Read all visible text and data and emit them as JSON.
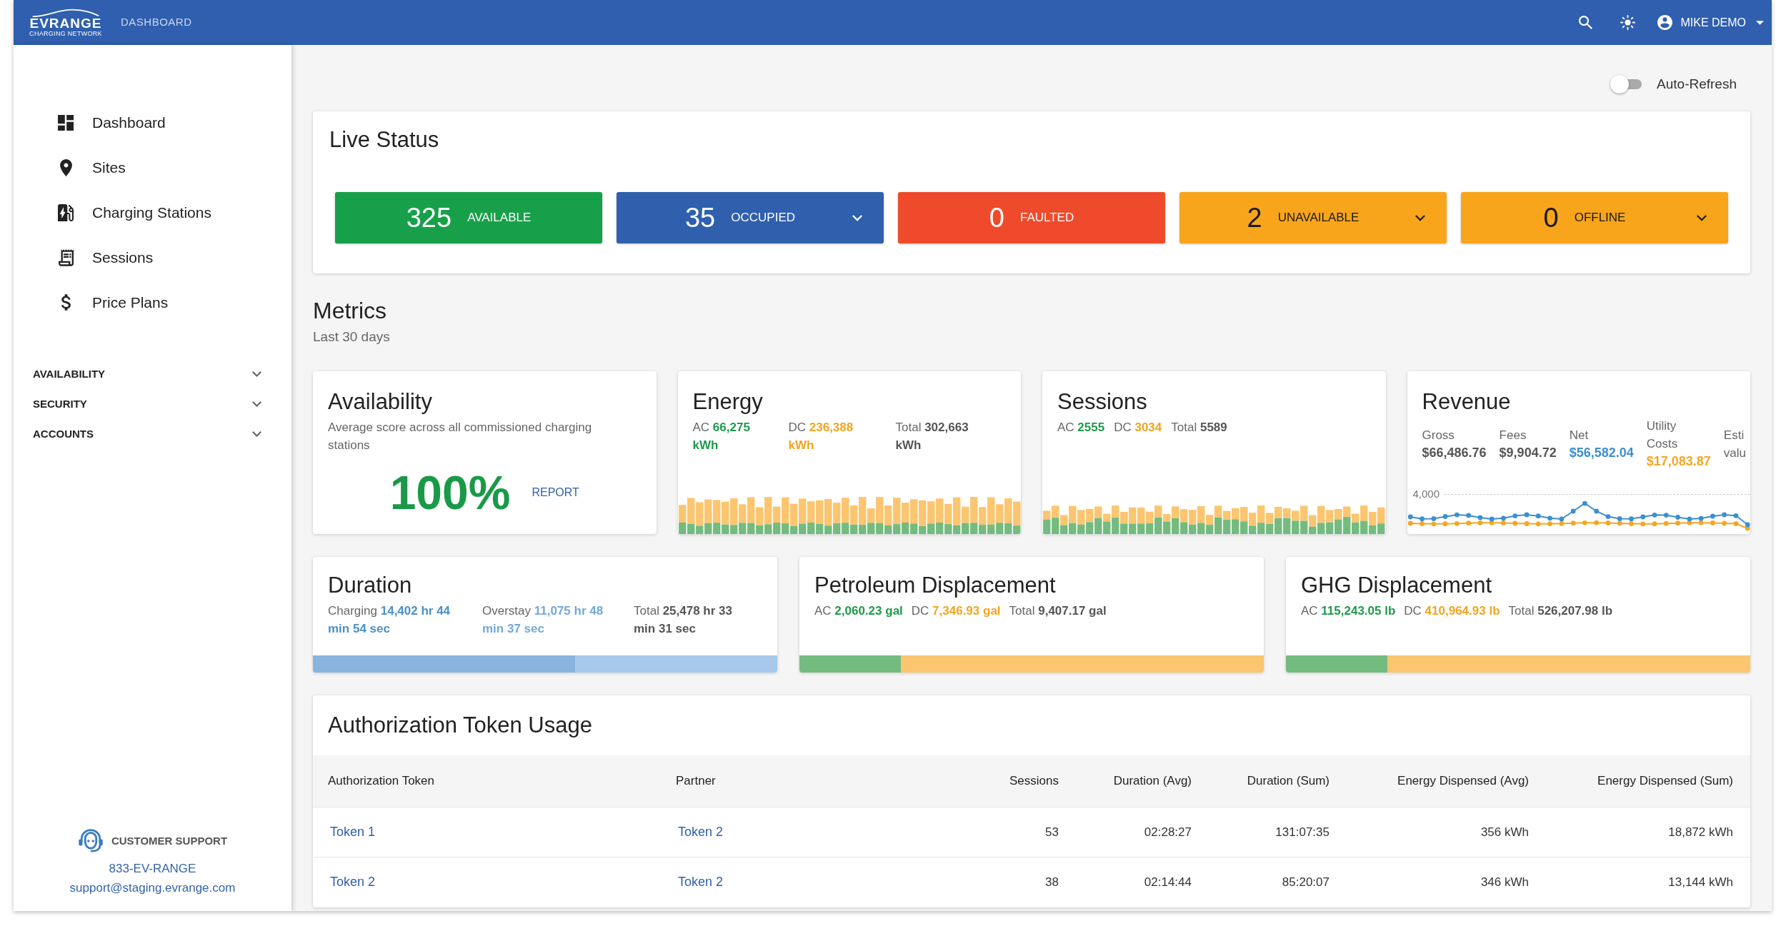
{
  "header": {
    "logo": {
      "name": "EVRANGE",
      "tagline": "CHARGING NETWORK"
    },
    "page_title": "DASHBOARD",
    "user": "MIKE DEMO"
  },
  "sidebar": {
    "nav": [
      {
        "label": "Dashboard"
      },
      {
        "label": "Sites"
      },
      {
        "label": "Charging Stations"
      },
      {
        "label": "Sessions"
      },
      {
        "label": "Price Plans"
      }
    ],
    "sections": [
      {
        "label": "AVAILABILITY",
        "expanded": false
      },
      {
        "label": "SECURITY",
        "expanded": false
      },
      {
        "label": "ACCOUNTS",
        "expanded": false
      }
    ],
    "support": {
      "title": "CUSTOMER SUPPORT",
      "phone": "833-EV-RANGE",
      "email": "support@staging.evrange.com"
    }
  },
  "auto_refresh": {
    "label": "Auto-Refresh",
    "on": false
  },
  "live_status": {
    "title": "Live Status",
    "tiles": [
      {
        "count": "325",
        "label": "AVAILABLE",
        "color": "#17a049",
        "kind": "plain"
      },
      {
        "count": "35",
        "label": "OCCUPIED",
        "color": "#305fae",
        "kind": "dropdown"
      },
      {
        "count": "0",
        "label": "FAULTED",
        "color": "#ef4a2b",
        "kind": "plain"
      },
      {
        "count": "2",
        "label": "UNAVAILABLE",
        "color": "#f8a51b",
        "kind": "dropdown"
      },
      {
        "count": "0",
        "label": "OFFLINE",
        "color": "#f8a51b",
        "kind": "dropdown"
      }
    ]
  },
  "metrics": {
    "title": "Metrics",
    "subtitle": "Last 30 days",
    "cards": [
      {
        "kind": "availability",
        "title": "Availability",
        "description": "Average score across all commissioned charging stations",
        "score": "100%",
        "link": "REPORT"
      },
      {
        "kind": "energy",
        "title": "Energy",
        "stats": [
          {
            "label": "AC",
            "value": "66,275 kWh",
            "color": "#1e9a4a"
          },
          {
            "label": "DC",
            "value": "236,388 kWh",
            "color": "#f2a51f"
          },
          {
            "label": "Total",
            "value": "302,663 kWh",
            "color": "#555555"
          }
        ]
      },
      {
        "kind": "sessions",
        "title": "Sessions",
        "stats": [
          {
            "label": "AC",
            "value": "2555",
            "color": "#1e9a4a"
          },
          {
            "label": "DC",
            "value": "3034",
            "color": "#f2a51f"
          },
          {
            "label": "Total",
            "value": "5589",
            "color": "#555555"
          }
        ]
      },
      {
        "kind": "revenue",
        "title": "Revenue",
        "stats": [
          {
            "label": "Gross",
            "value": "$66,486.76",
            "color": "#555555"
          },
          {
            "label": "Fees",
            "value": "$9,904.72",
            "color": "#555555"
          },
          {
            "label": "Net",
            "value": "$56,582.04",
            "color": "#3d8fd0"
          },
          {
            "label": "Utility Costs",
            "value": "$17,083.87",
            "color": "#f5a623"
          },
          {
            "label": "Esti valu"
          }
        ],
        "chart_label": "4,000"
      },
      {
        "kind": "duration",
        "title": "Duration",
        "stats": [
          {
            "label": "Charging",
            "value": "14,402 hr 44 min 54 sec",
            "color": "#4a90c8"
          },
          {
            "label": "Overstay",
            "value": "11,075 hr 48 min 37 sec",
            "color": "#72a9db"
          },
          {
            "label": "Total",
            "value": "25,478 hr 33 min 31 sec",
            "color": "#555555"
          }
        ],
        "bar": {
          "level": 0.565
        }
      },
      {
        "kind": "displacement",
        "title": "Petroleum Displacement",
        "stats": [
          {
            "label": "AC",
            "value": "2,060.23 gal",
            "color": "#1e9a4a"
          },
          {
            "label": "DC",
            "value": "7,346.93 gal",
            "color": "#f2a51f"
          },
          {
            "label": "Total",
            "value": "9,407.17 gal",
            "color": "#555555"
          }
        ],
        "bar": {
          "level": 0.219
        }
      },
      {
        "kind": "displacement",
        "title": "GHG Displacement",
        "stats": [
          {
            "label": "AC",
            "value": "115,243.05 lb",
            "color": "#1e9a4a"
          },
          {
            "label": "DC",
            "value": "410,964.93 lb",
            "color": "#f2a51f"
          },
          {
            "label": "Total",
            "value": "526,207.98 lb",
            "color": "#555555"
          }
        ],
        "bar": {
          "level": 0.219
        }
      }
    ]
  },
  "token_usage": {
    "title": "Authorization Token Usage",
    "columns": [
      "Authorization Token",
      "Partner",
      "Sessions",
      "Duration (Avg)",
      "Duration (Sum)",
      "Energy Dispensed (Avg)",
      "Energy Dispensed (Sum)"
    ],
    "rows": [
      [
        "Token 1",
        "Token 2",
        "53",
        "02:28:27",
        "131:07:35",
        "356 kWh",
        "18,872 kWh"
      ],
      [
        "Token 2",
        "Token 2",
        "38",
        "02:14:44",
        "85:20:07",
        "346 kWh",
        "13,144 kWh"
      ]
    ]
  }
}
